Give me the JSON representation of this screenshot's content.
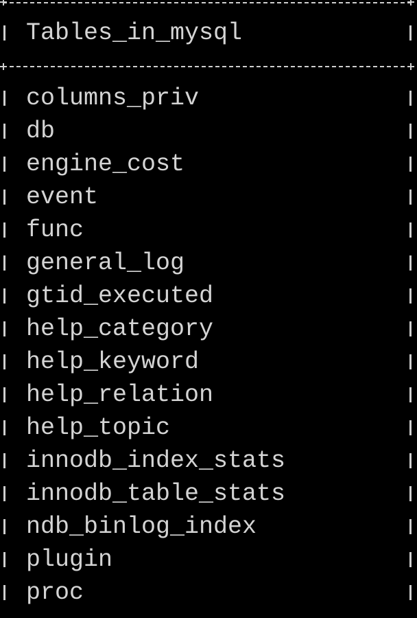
{
  "table": {
    "header": "Tables_in_mysql",
    "rows": [
      "columns_priv",
      "db",
      "engine_cost",
      "event",
      "func",
      "general_log",
      "gtid_executed",
      "help_category",
      "help_keyword",
      "help_relation",
      "help_topic",
      "innodb_index_stats",
      "innodb_table_stats",
      "ndb_binlog_index",
      "plugin",
      "proc"
    ]
  },
  "colors": {
    "background": "#000000",
    "text": "#d4d4d4",
    "border": "#cfcfcf"
  }
}
